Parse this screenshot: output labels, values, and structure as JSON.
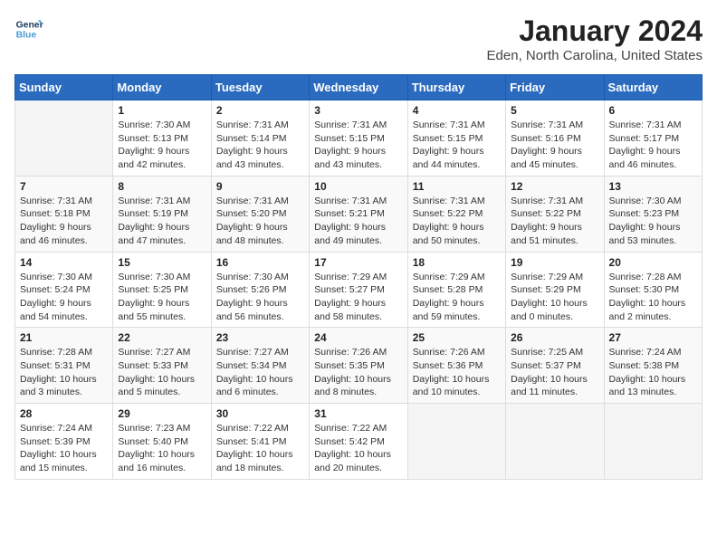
{
  "header": {
    "logo_line1": "General",
    "logo_line2": "Blue",
    "main_title": "January 2024",
    "subtitle": "Eden, North Carolina, United States"
  },
  "weekdays": [
    "Sunday",
    "Monday",
    "Tuesday",
    "Wednesday",
    "Thursday",
    "Friday",
    "Saturday"
  ],
  "weeks": [
    [
      {
        "day": "",
        "info": ""
      },
      {
        "day": "1",
        "info": "Sunrise: 7:30 AM\nSunset: 5:13 PM\nDaylight: 9 hours\nand 42 minutes."
      },
      {
        "day": "2",
        "info": "Sunrise: 7:31 AM\nSunset: 5:14 PM\nDaylight: 9 hours\nand 43 minutes."
      },
      {
        "day": "3",
        "info": "Sunrise: 7:31 AM\nSunset: 5:15 PM\nDaylight: 9 hours\nand 43 minutes."
      },
      {
        "day": "4",
        "info": "Sunrise: 7:31 AM\nSunset: 5:15 PM\nDaylight: 9 hours\nand 44 minutes."
      },
      {
        "day": "5",
        "info": "Sunrise: 7:31 AM\nSunset: 5:16 PM\nDaylight: 9 hours\nand 45 minutes."
      },
      {
        "day": "6",
        "info": "Sunrise: 7:31 AM\nSunset: 5:17 PM\nDaylight: 9 hours\nand 46 minutes."
      }
    ],
    [
      {
        "day": "7",
        "info": "Sunrise: 7:31 AM\nSunset: 5:18 PM\nDaylight: 9 hours\nand 46 minutes."
      },
      {
        "day": "8",
        "info": "Sunrise: 7:31 AM\nSunset: 5:19 PM\nDaylight: 9 hours\nand 47 minutes."
      },
      {
        "day": "9",
        "info": "Sunrise: 7:31 AM\nSunset: 5:20 PM\nDaylight: 9 hours\nand 48 minutes."
      },
      {
        "day": "10",
        "info": "Sunrise: 7:31 AM\nSunset: 5:21 PM\nDaylight: 9 hours\nand 49 minutes."
      },
      {
        "day": "11",
        "info": "Sunrise: 7:31 AM\nSunset: 5:22 PM\nDaylight: 9 hours\nand 50 minutes."
      },
      {
        "day": "12",
        "info": "Sunrise: 7:31 AM\nSunset: 5:22 PM\nDaylight: 9 hours\nand 51 minutes."
      },
      {
        "day": "13",
        "info": "Sunrise: 7:30 AM\nSunset: 5:23 PM\nDaylight: 9 hours\nand 53 minutes."
      }
    ],
    [
      {
        "day": "14",
        "info": "Sunrise: 7:30 AM\nSunset: 5:24 PM\nDaylight: 9 hours\nand 54 minutes."
      },
      {
        "day": "15",
        "info": "Sunrise: 7:30 AM\nSunset: 5:25 PM\nDaylight: 9 hours\nand 55 minutes."
      },
      {
        "day": "16",
        "info": "Sunrise: 7:30 AM\nSunset: 5:26 PM\nDaylight: 9 hours\nand 56 minutes."
      },
      {
        "day": "17",
        "info": "Sunrise: 7:29 AM\nSunset: 5:27 PM\nDaylight: 9 hours\nand 58 minutes."
      },
      {
        "day": "18",
        "info": "Sunrise: 7:29 AM\nSunset: 5:28 PM\nDaylight: 9 hours\nand 59 minutes."
      },
      {
        "day": "19",
        "info": "Sunrise: 7:29 AM\nSunset: 5:29 PM\nDaylight: 10 hours\nand 0 minutes."
      },
      {
        "day": "20",
        "info": "Sunrise: 7:28 AM\nSunset: 5:30 PM\nDaylight: 10 hours\nand 2 minutes."
      }
    ],
    [
      {
        "day": "21",
        "info": "Sunrise: 7:28 AM\nSunset: 5:31 PM\nDaylight: 10 hours\nand 3 minutes."
      },
      {
        "day": "22",
        "info": "Sunrise: 7:27 AM\nSunset: 5:33 PM\nDaylight: 10 hours\nand 5 minutes."
      },
      {
        "day": "23",
        "info": "Sunrise: 7:27 AM\nSunset: 5:34 PM\nDaylight: 10 hours\nand 6 minutes."
      },
      {
        "day": "24",
        "info": "Sunrise: 7:26 AM\nSunset: 5:35 PM\nDaylight: 10 hours\nand 8 minutes."
      },
      {
        "day": "25",
        "info": "Sunrise: 7:26 AM\nSunset: 5:36 PM\nDaylight: 10 hours\nand 10 minutes."
      },
      {
        "day": "26",
        "info": "Sunrise: 7:25 AM\nSunset: 5:37 PM\nDaylight: 10 hours\nand 11 minutes."
      },
      {
        "day": "27",
        "info": "Sunrise: 7:24 AM\nSunset: 5:38 PM\nDaylight: 10 hours\nand 13 minutes."
      }
    ],
    [
      {
        "day": "28",
        "info": "Sunrise: 7:24 AM\nSunset: 5:39 PM\nDaylight: 10 hours\nand 15 minutes."
      },
      {
        "day": "29",
        "info": "Sunrise: 7:23 AM\nSunset: 5:40 PM\nDaylight: 10 hours\nand 16 minutes."
      },
      {
        "day": "30",
        "info": "Sunrise: 7:22 AM\nSunset: 5:41 PM\nDaylight: 10 hours\nand 18 minutes."
      },
      {
        "day": "31",
        "info": "Sunrise: 7:22 AM\nSunset: 5:42 PM\nDaylight: 10 hours\nand 20 minutes."
      },
      {
        "day": "",
        "info": ""
      },
      {
        "day": "",
        "info": ""
      },
      {
        "day": "",
        "info": ""
      }
    ]
  ]
}
